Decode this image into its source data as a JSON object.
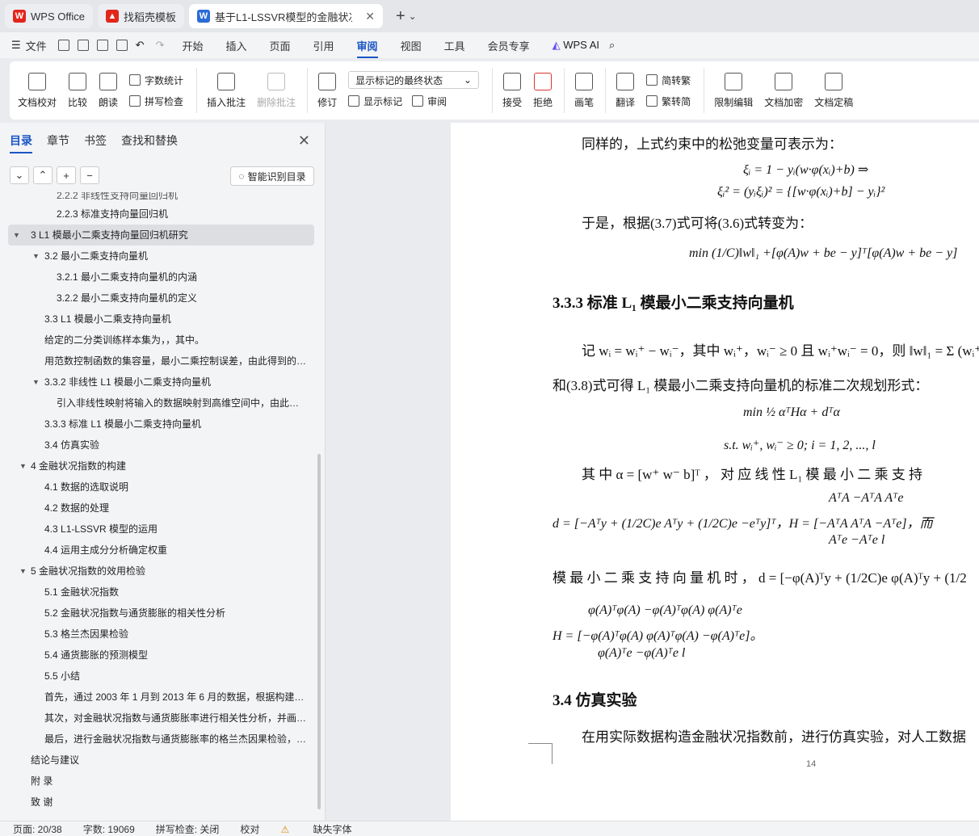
{
  "tabs": [
    {
      "label": "WPS Office"
    },
    {
      "label": "找稻壳模板"
    },
    {
      "label": "基于L1-LSSVR模型的金融状况"
    }
  ],
  "menu": {
    "file": "文件",
    "items": [
      "开始",
      "插入",
      "页面",
      "引用",
      "审阅",
      "视图",
      "工具",
      "会员专享"
    ],
    "active": "审阅",
    "ai": "WPS AI"
  },
  "ribbon": {
    "proof": "文档校对",
    "compare": "比较",
    "read": "朗读",
    "wordcount": "字数统计",
    "spell": "拼写检查",
    "insert_comment": "插入批注",
    "delete_comment": "删除批注",
    "revise": "修订",
    "markup_select": "显示标记的最终状态",
    "show_markup": "显示标记",
    "review": "审阅",
    "accept": "接受",
    "reject": "拒绝",
    "pen": "画笔",
    "translate": "翻译",
    "trad": "简转繁",
    "simp": "繁转简",
    "restrict": "限制编辑",
    "encrypt": "文档加密",
    "finalize": "文档定稿"
  },
  "sidebar": {
    "tabs": [
      "目录",
      "章节",
      "书签",
      "查找和替换"
    ],
    "smart": "智能识别目录",
    "toc": [
      {
        "t": "2.2.2  非线性支持向量回归机"
      },
      {
        "t": "2.2.3  标准支持向量回归机"
      },
      {
        "t": "3  L1 模最小二乘支持向量回归机研究"
      },
      {
        "t": "3.2  最小二乘支持向量机"
      },
      {
        "t": "3.2.1  最小二乘支持向量机的内涵"
      },
      {
        "t": "3.2.2  最小二乘支持向量机的定义"
      },
      {
        "t": "3.3 L1 模最小二乘支持向量机"
      },
      {
        "t": "给定的二分类训练样本集为，，其中。"
      },
      {
        "t": "用范数控制函数的集容量，最小二乘控制误差，由此得到的…"
      },
      {
        "t": "3.3.2  非线性 L1 模最小二乘支持向量机"
      },
      {
        "t": "引入非线性映射将输入的数据映射到高维空间中，由此…"
      },
      {
        "t": "3.3.3  标准 L1 模最小二乘支持向量机"
      },
      {
        "t": "3.4  仿真实验"
      },
      {
        "t": "4  金融状况指数的构建"
      },
      {
        "t": "4.1  数据的选取说明"
      },
      {
        "t": "4.2  数据的处理"
      },
      {
        "t": "4.3 L1-LSSVR 模型的运用"
      },
      {
        "t": "4.4  运用主成分分析确定权重"
      },
      {
        "t": "5  金融状况指数的效用检验"
      },
      {
        "t": "5.1  金融状况指数"
      },
      {
        "t": "5.2  金融状况指数与通货膨胀的相关性分析"
      },
      {
        "t": "5.3  格兰杰因果检验"
      },
      {
        "t": "5.4  通货膨胀的预测模型"
      },
      {
        "t": "5.5  小结"
      },
      {
        "t": "首先，通过 2003 年 1 月到 2013 年 6 月的数据，根据构建…"
      },
      {
        "t": "其次，对金融状况指数与通货膨胀率进行相关性分析，并画…"
      },
      {
        "t": "最后，进行金融状况指数与通货膨胀率的格兰杰因果检验，…"
      },
      {
        "t": "结论与建议"
      },
      {
        "t": "附  录"
      },
      {
        "t": "致  谢"
      }
    ]
  },
  "doc": {
    "p1": "同样的，上式约束中的松弛变量可表示为：",
    "eq1": "ξᵢ = 1 − yᵢ(w·φ(xᵢ)+b) ⇒",
    "eq2": "ξᵢ² = (yᵢξᵢ)² = {[w·φ(xᵢ)+b] − yᵢ}²",
    "p2": "于是，根据(3.7)式可将(3.6)式转变为：",
    "eq3": "min  (1/C)‖w‖₁ +[φ(A)w + be − y]ᵀ[φ(A)w + be − y]",
    "h333": "3.3.3  标准 L₁ 模最小二乘支持向量机",
    "p3": "记 wᵢ = wᵢ⁺ − wᵢ⁻，其中 wᵢ⁺，wᵢ⁻ ≥ 0 且 wᵢ⁺wᵢ⁻ = 0，则 ‖w‖₁ = Σ (wᵢ⁺ +",
    "p4": "和(3.8)式可得 L₁ 模最小二乘支持向量机的标准二次规划形式：",
    "eq4": "min  ½ αᵀHα + dᵀα",
    "eq5": "s.t.  wᵢ⁺, wᵢ⁻ ≥ 0; i = 1, 2, ..., l",
    "p5": "其 中  α = [w⁺ w⁻ b]ᵀ ， 对 应 线 性  L₁ 模 最 小 二 乘 支 持",
    "eq6": "d = [−Aᵀy + (1/2C)e   Aᵀy + (1/2C)e   −eᵀy]ᵀ，H = [−AᵀA   AᵀA   −Aᵀe]，而",
    "eq6top": "AᵀA      −AᵀA      Aᵀe",
    "eq6bot": "Aᵀe      −Aᵀe       l",
    "p6": "模 最 小 二 乘 支 持 向 量 机 时 ，  d = [−φ(A)ᵀy + (1/2C)e   φ(A)ᵀy + (1/2",
    "eq7top": "φ(A)ᵀφ(A)     −φ(A)ᵀφ(A)     φ(A)ᵀe",
    "eq7mid": "H = [−φ(A)ᵀφ(A)     φ(A)ᵀφ(A)     −φ(A)ᵀe]。",
    "eq7bot": "φ(A)ᵀe          −φ(A)ᵀe            l",
    "h34": "3.4  仿真实验",
    "p7": "在用实际数据构造金融状况指数前，进行仿真实验，对人工数据",
    "pagenum": "14"
  },
  "status": {
    "page": "页面: 20/38",
    "words": "字数: 19069",
    "spell": "拼写检查: 关闭",
    "proof": "校对",
    "font": "缺失字体"
  }
}
